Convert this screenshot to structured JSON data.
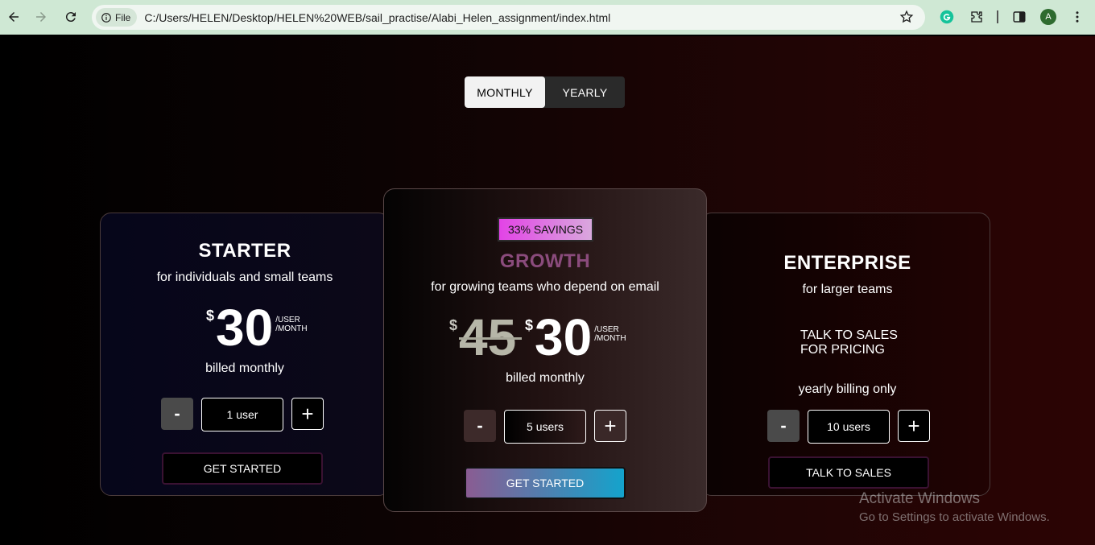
{
  "browser": {
    "file_label": "File",
    "url": "C:/Users/HELEN/Desktop/HELEN%20WEB/sail_practise/Alabi_Helen_assignment/index.html",
    "avatar_letter": "A"
  },
  "billing_toggle": {
    "monthly": "MONTHLY",
    "yearly": "YEARLY",
    "selected": "MONTHLY"
  },
  "plans": {
    "starter": {
      "title": "STARTER",
      "subtitle": "for individuals and small teams",
      "currency": "$",
      "price": "30",
      "unit_line1": "/USER",
      "unit_line2": "/MONTH",
      "billing": "billed monthly",
      "minus": "-",
      "plus": "+",
      "users": "1 user",
      "cta": "GET STARTED"
    },
    "growth": {
      "badge": "33% SAVINGS",
      "title": "GROWTH",
      "subtitle": "for growing teams who depend on email",
      "old_currency": "$",
      "old_price": "45",
      "currency": "$",
      "price": "30",
      "unit_line1": "/USER",
      "unit_line2": "/MONTH",
      "billing": "billed monthly",
      "minus": "-",
      "plus": "+",
      "users": "5 users",
      "cta": "GET STARTED"
    },
    "enterprise": {
      "title": "ENTERPRISE",
      "subtitle": "for larger teams",
      "pricing_line1": "TALK TO SALES",
      "pricing_line2": "FOR PRICING",
      "billing": "yearly billing only",
      "minus": "-",
      "plus": "+",
      "users": "10 users",
      "cta": "TALK TO SALES"
    }
  },
  "watermark": {
    "line1": "Activate Windows",
    "line2": "Go to Settings to activate Windows."
  },
  "colors": {
    "growth_title": "#8a4b7c",
    "badge_start": "#e243e6",
    "cta_gradient_start": "#8a5c92",
    "cta_gradient_end": "#14a3cc"
  }
}
